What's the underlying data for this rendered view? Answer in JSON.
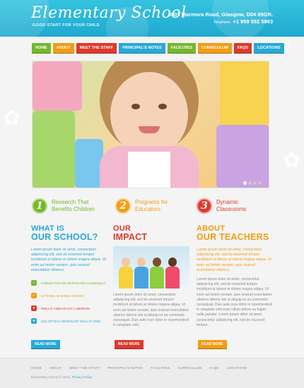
{
  "colors": {
    "header": "#27b6d8",
    "green": "#76b82a",
    "orange": "#f39c11",
    "red": "#e0382d",
    "blue": "#27a9d8",
    "pink": "#e9388d"
  },
  "header": {
    "logo": "Elementary School",
    "tagline": "GOOD START FOR YOUR CHILD",
    "address": "8901 Marmora Road, Glasgow,  D04 89GR.",
    "phone_label": "Telephone:",
    "phone": "+1 959 552 5963"
  },
  "nav": [
    {
      "label": "HOME",
      "color": "#76b82a"
    },
    {
      "label": "ABOUT",
      "color": "#f39c11"
    },
    {
      "label": "MEET THE STAFF",
      "color": "#e0382d"
    },
    {
      "label": "PRINCIPAL'S NOTES",
      "color": "#27a9d8"
    },
    {
      "label": "FACILITIES",
      "color": "#76b82a"
    },
    {
      "label": "CURRICULUM",
      "color": "#f39c11"
    },
    {
      "label": "FAQS",
      "color": "#e0382d"
    },
    {
      "label": "LOCATIONS",
      "color": "#27a9d8"
    }
  ],
  "slider": {
    "total_slides": 4,
    "active_slide": 1
  },
  "features": [
    {
      "number": "1",
      "line1": "Research That",
      "line2": "Benefits Children",
      "color": "#76b82a"
    },
    {
      "number": "2",
      "line1": "Programs for",
      "line2": "Educators",
      "color": "#f39c11"
    },
    {
      "number": "3",
      "line1": "Dynamic",
      "line2": "Classrooms",
      "color": "#e0382d"
    }
  ],
  "columns": {
    "school": {
      "title1": "WHAT IS",
      "title2": "OUR SCHOOL?",
      "lead": "Lorem ipsum dolor sit amet, consectetur adipisicing elit, sed do eiusmod tempor incididunt ut labore et dolore magna aliqua. Ut enim ad minim veniam, quis nostrud exercitation ullamco.",
      "list": [
        {
          "text": "CONSECTETUR ADIPISICING CONSEQUA",
          "color": "#76b82a",
          "icon": "check-icon"
        },
        {
          "text": "UT ENIM AD MINIM VENIAM",
          "color": "#f39c11",
          "icon": "bolt-icon"
        },
        {
          "text": "MOLLIT ANIM ID EST LABORUM",
          "color": "#e0382d",
          "icon": "heart-icon"
        },
        {
          "text": "QUI OFFICIA DESERUNT MOLLIT ANIM",
          "color": "#27a9d8",
          "icon": "star-icon"
        }
      ],
      "button": "READ MORE"
    },
    "impact": {
      "title1": "OUR",
      "title2": "IMPACT",
      "body": "Lorem ipsum dolor sit amet, consectetur adipisicing elit, sed do eiusmod tempor incididunt ut labore et dolore magna aliqua. Ut enim ad minim veniam, quis nostrud exercitation ullamco laboris nisi ut aliquip ex ea commodo consequat. Duis aute irure dolor in reprehenderit in voluptate velit.",
      "button": "READ MORE"
    },
    "teachers": {
      "title1": "ABOUT",
      "title2": "OUR TEACHERS",
      "lead": "Lorem ipsum dolor sit amet, consectetur adipisicing elit, sed do eiusmod tempor incididunt ut labore et dolore magna aliqua. Ut enim ad minim veniam, quis nostrud exercitation ullamco.",
      "body": "Lorem ipsum dolor sit amet, consectetur adipisicing elit, sed do eiusmod tempor incididunt ut labore et dolore magna aliqua. Ut enim ad minim veniam, quis nostrud exercitation ullamco laboris nisi ut aliquip ex ea commodo consequat. Duis aute irure dolor in reprehenderit in voluptate velit esse cillum dolore eu fugiat nulla pariatur. Lorem ipsum dolor sit amet, consectetur adipisicing elit, sed do eiusmod tempor.",
      "button": "READ MORE"
    }
  },
  "footer": {
    "nav": [
      "HOME",
      "ABOUT",
      "MEET THE STAFF",
      "PRINCIPAL'S NOTES",
      "FACILITIES",
      "CURRICULUM",
      "FAQS",
      "LOCATIONS"
    ],
    "copyright": "Elementary School © 2013",
    "privacy": "Privacy Policy"
  }
}
